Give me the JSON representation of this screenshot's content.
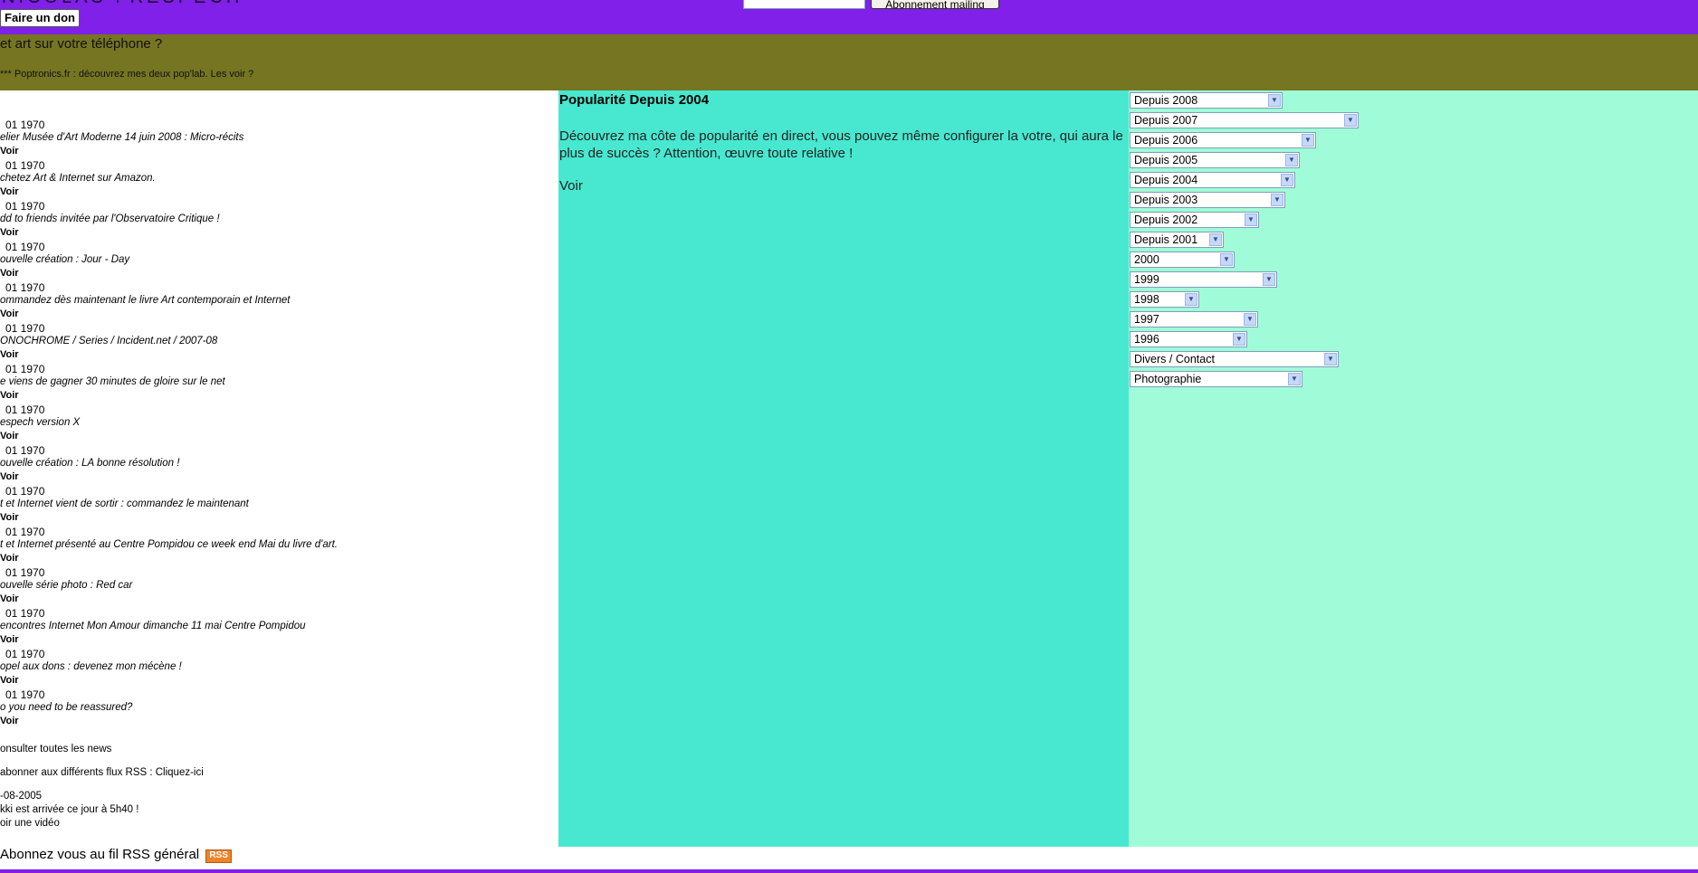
{
  "header": {
    "site_title": "NICOLAS FRESPECH",
    "donate_label": "Faire un don",
    "mailing_input_value": "",
    "mailing_button_label": "Abonnement mailing"
  },
  "banner": {
    "phone_text": "et art sur votre téléphone ?",
    "poptronics_text": "*** Poptronics.fr : découvrez mes deux pop'lab. Les voir ?"
  },
  "news": [
    {
      "date": "01 1970",
      "title": "elier Musée d'Art Moderne 14 juin 2008 : Micro-récits",
      "voir": "Voir"
    },
    {
      "date": "01 1970",
      "title": "chetez Art & Internet sur Amazon.",
      "voir": "Voir"
    },
    {
      "date": "01 1970",
      "title": "dd to friends invitée par l'Observatoire Critique !",
      "voir": "Voir"
    },
    {
      "date": "01 1970",
      "title": "ouvelle création : Jour - Day",
      "voir": "Voir"
    },
    {
      "date": "01 1970",
      "title": "ommandez dès maintenant le livre Art contemporain et Internet",
      "voir": "Voir"
    },
    {
      "date": "01 1970",
      "title": "ONOCHROME / Series / Incident.net / 2007-08",
      "voir": "Voir"
    },
    {
      "date": "01 1970",
      "title": "e viens de gagner 30 minutes de gloire sur le net",
      "voir": "Voir"
    },
    {
      "date": "01 1970",
      "title": "espech version X",
      "voir": "Voir"
    },
    {
      "date": "01 1970",
      "title": "ouvelle création : LA bonne résolution !",
      "voir": "Voir"
    },
    {
      "date": "01 1970",
      "title": "t et Internet vient de sortir : commandez le maintenant",
      "voir": "Voir"
    },
    {
      "date": "01 1970",
      "title": "t et Internet présenté au Centre Pompidou ce week end Mai du livre d'art.",
      "voir": "Voir"
    },
    {
      "date": "01 1970",
      "title": "ouvelle série photo : Red car",
      "voir": "Voir"
    },
    {
      "date": "01 1970",
      "title": "encontres Internet Mon Amour dimanche 11 mai Centre Pompidou",
      "voir": "Voir"
    },
    {
      "date": "01 1970",
      "title": "opel aux dons : devenez mon mécène !",
      "voir": "Voir"
    },
    {
      "date": "01 1970",
      "title": "o you need to be reassured?",
      "voir": "Voir"
    }
  ],
  "left_footer": {
    "all_news": "onsulter toutes les news",
    "rss_flux": "abonner aux différents flux RSS : Cliquez-ici",
    "date_line": "-08-2005",
    "birth_line": "kki est arrivée ce jour à 5h40 !",
    "video_link": "oir une vidéo"
  },
  "popularity": {
    "title": "Popularité Depuis 2004",
    "text": "Découvrez ma côte de popularité en direct, vous pouvez même configurer la votre, qui aura le plus de succès ? Attention, œuvre toute relative !",
    "voir": "Voir"
  },
  "selects": [
    {
      "label": "Depuis 2008"
    },
    {
      "label": "Depuis 2007"
    },
    {
      "label": "Depuis 2006"
    },
    {
      "label": "Depuis 2005"
    },
    {
      "label": "Depuis 2004"
    },
    {
      "label": "Depuis 2003"
    },
    {
      "label": "Depuis 2002"
    },
    {
      "label": "Depuis 2001"
    },
    {
      "label": "2000"
    },
    {
      "label": "1999"
    },
    {
      "label": "1998"
    },
    {
      "label": "1997"
    },
    {
      "label": "1996"
    },
    {
      "label": "Divers / Contact"
    },
    {
      "label": "Photographie"
    }
  ],
  "footer": {
    "rss_text": "Abonnez vous au fil RSS général",
    "rss_badge": "RSS"
  },
  "colors": {
    "topbar": "#8020e8",
    "banner": "#767522",
    "middle_column": "#48e8d0",
    "right_column": "#a0fcd8"
  }
}
